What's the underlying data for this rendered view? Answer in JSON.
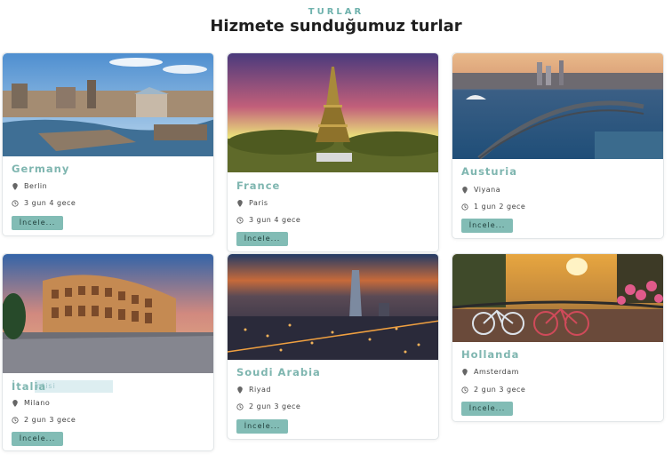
{
  "header": {
    "eyebrow": "TURLAR",
    "title": "Hizmete sunduğumuz turlar"
  },
  "tours": [
    {
      "name": "Germany",
      "city": "Berlin",
      "duration": "3 gun 4 gece",
      "button": "İncele..."
    },
    {
      "name": "France",
      "city": "Paris",
      "duration": "3 gun 4 gece",
      "button": "İncele..."
    },
    {
      "name": "Austuria",
      "city": "Viyana",
      "duration": "1 gun 2 gece",
      "button": "İncele..."
    },
    {
      "name": "İtalia",
      "city": "Milano",
      "duration": "2 gun 3 gece",
      "button": "İncele...",
      "overlay_text": "ntisi"
    },
    {
      "name": "Soudi Arabia",
      "city": "Riyad",
      "duration": "2 gun 3 gece",
      "button": "İncele..."
    },
    {
      "name": "Hollanda",
      "city": "Amsterdam",
      "duration": "2 gun 3 gece",
      "button": "İncele..."
    }
  ],
  "icons": {
    "location": "map-pin-icon",
    "time": "clock-icon"
  },
  "colors": {
    "accent": "#7fb6b0",
    "button_bg": "#82bcb5",
    "eyebrow": "#6fb2ad"
  }
}
